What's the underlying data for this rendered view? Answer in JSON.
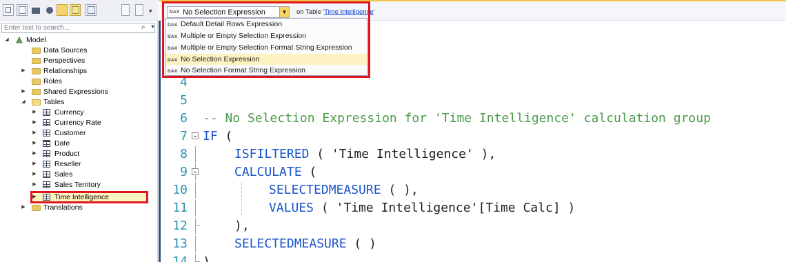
{
  "search": {
    "placeholder": "Enter text to search..."
  },
  "tree": {
    "root": "Model",
    "items": [
      "Data Sources",
      "Perspectives",
      "Relationships",
      "Roles",
      "Shared Expressions",
      "Tables",
      "Currency",
      "Currency Rate",
      "Customer",
      "Date",
      "Product",
      "Reseller",
      "Sales",
      "Sales Territory",
      "Time Intelligence",
      "Translations"
    ]
  },
  "expression_bar": {
    "dax_badge": "DAX",
    "selected": "No Selection Expression",
    "on_table_prefix": "on Table '",
    "table_link": "Time Intelligence",
    "on_table_suffix": "'",
    "options": [
      "Default Detail Rows Expression",
      "Multiple or Empty Selection Expression",
      "Multiple or Empty Selection Format String Expression",
      "No Selection Expression",
      "No Selection Format String Expression"
    ]
  },
  "code": {
    "line_numbers": [
      "4",
      "5",
      "6",
      "7",
      "8",
      "9",
      "10",
      "11",
      "12",
      "13",
      "14"
    ],
    "l6": "-- No Selection Expression for 'Time Intelligence' calculation group",
    "l7_kw": "IF",
    "l7_rest": " (",
    "l8_kw": "ISFILTERED",
    "l8_rest": " ( 'Time Intelligence' ),",
    "l9_kw": "CALCULATE",
    "l9_rest": " (",
    "l10_kw": "SELECTEDMEASURE",
    "l10_rest": " ( ),",
    "l11_kw": "VALUES",
    "l11_rest": " ( 'Time Intelligence'[Time Calc] )",
    "l12": "),",
    "l13_kw": "SELECTEDMEASURE",
    "l13_rest": " ( )",
    "l14": ")"
  },
  "colors": {
    "keyword": "#1a55c9",
    "comment": "#4b9b4b",
    "line_number": "#2b91af",
    "highlight_border": "#e0161f",
    "selection": "#fdf3c2"
  }
}
